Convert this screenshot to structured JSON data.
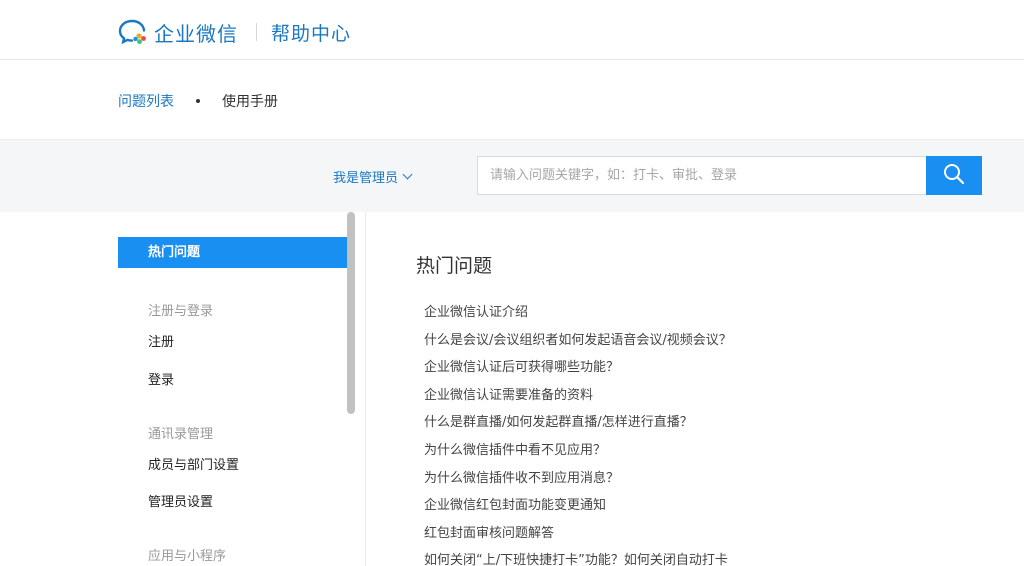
{
  "header": {
    "brand": "企业微信",
    "section": "帮助中心"
  },
  "breadcrumb": {
    "link": "问题列表",
    "current": "使用手册"
  },
  "search": {
    "role_label": "我是管理员",
    "placeholder": "请输入问题关键字，如：打卡、审批、登录"
  },
  "sidebar": {
    "active": "热门问题",
    "groups": [
      {
        "title": "注册与登录",
        "items": [
          "注册",
          "登录"
        ]
      },
      {
        "title": "通讯录管理",
        "items": [
          "成员与部门设置",
          "管理员设置"
        ]
      },
      {
        "title": "应用与小程序",
        "items": []
      }
    ]
  },
  "main": {
    "title": "热门问题",
    "questions": [
      "企业微信认证介绍",
      "什么是会议/会议组织者如何发起语音会议/视频会议？",
      "企业微信认证后可获得哪些功能？",
      "企业微信认证需要准备的资料",
      "什么是群直播/如何发起群直播/怎样进行直播？",
      "为什么微信插件中看不见应用？",
      "为什么微信插件收不到应用消息？",
      "企业微信红包封面功能变更通知",
      "红包封面审核问题解答",
      "如何关闭“上/下班快捷打卡”功能？如何关闭自动打卡"
    ]
  },
  "colors": {
    "accent": "#1a8ff2",
    "link": "#1a78c2"
  },
  "icons": {
    "logo": "wecom-logo-icon",
    "search": "search-icon",
    "dropdown": "chevron-down-icon"
  }
}
